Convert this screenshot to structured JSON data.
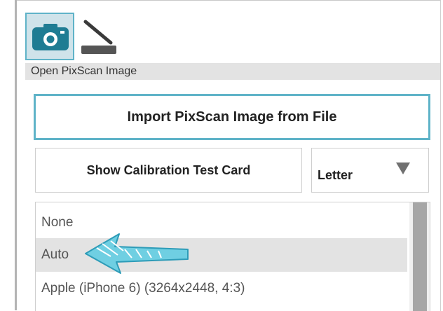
{
  "toolbar": {
    "camera_icon": "camera-icon",
    "scanner_icon": "scanner-icon"
  },
  "section": {
    "title": "Open PixScan Image"
  },
  "import_button": {
    "label": "Import PixScan Image from File"
  },
  "calibration_button": {
    "label": "Show Calibration Test Card"
  },
  "paper_size": {
    "selected": "Letter"
  },
  "profile_list": {
    "items": [
      {
        "label": "None",
        "selected": false
      },
      {
        "label": "Auto",
        "selected": true
      },
      {
        "label": "Apple (iPhone 6) (3264x2448, 4:3)",
        "selected": false
      }
    ]
  },
  "annotation": {
    "icon": "arrow-pointer-icon",
    "color": "#5fc0d6"
  },
  "colors": {
    "accent": "#5fb3c8",
    "camera_icon": "#1f7c93",
    "header_bg": "#e3e3e3",
    "selected_row_bg": "#e3e3e3"
  }
}
